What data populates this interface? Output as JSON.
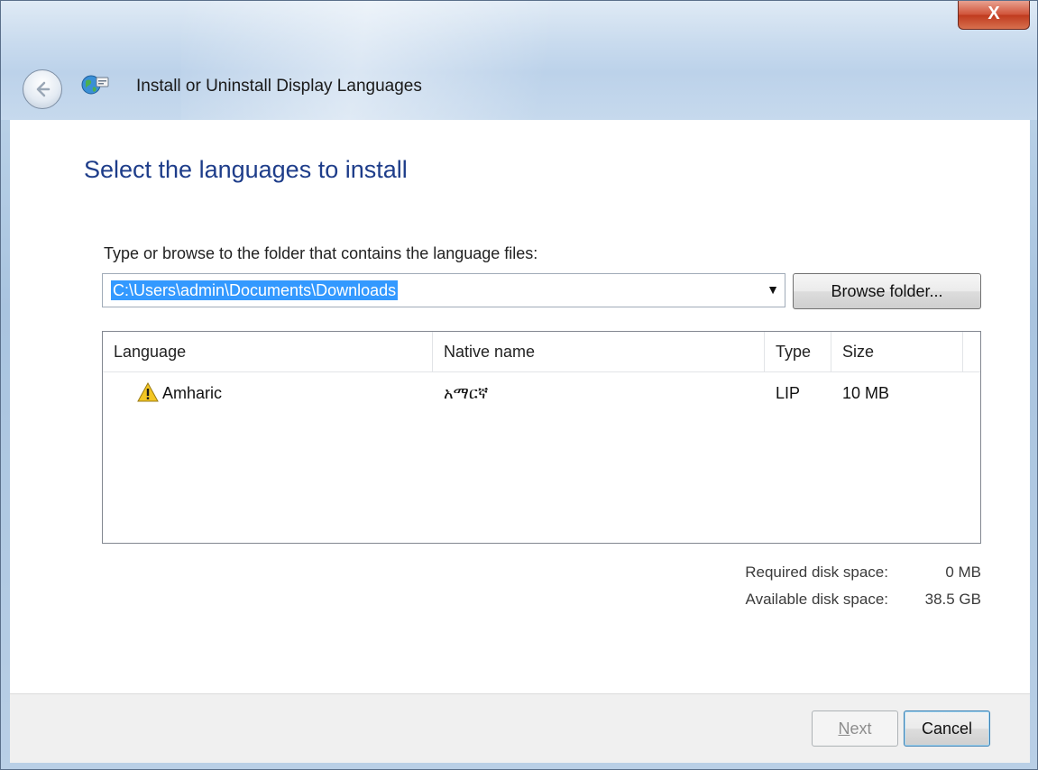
{
  "window": {
    "title": "Install or Uninstall Display Languages",
    "close_glyph": "X"
  },
  "header": {
    "heading": "Select the languages to install",
    "folder_label": "Type or browse to the folder that contains the language files:"
  },
  "folder": {
    "path": "C:\\Users\\admin\\Documents\\Downloads",
    "browse_label": "Browse folder..."
  },
  "list": {
    "columns": [
      "Language",
      "Native name",
      "Type",
      "Size"
    ],
    "rows": [
      {
        "language": "Amharic",
        "native": "አማርኛ",
        "type": "LIP",
        "size": "10 MB",
        "icon": "warning-icon"
      }
    ]
  },
  "disk": {
    "required_label": "Required disk space:",
    "required_value": "0 MB",
    "available_label": "Available disk space:",
    "available_value": "38.5 GB"
  },
  "footer": {
    "next_label": "Next",
    "cancel_label": "Cancel"
  },
  "icons": {
    "back": "back-arrow-icon",
    "app": "globe-language-icon",
    "dropdown": "chevron-down-icon"
  },
  "colors": {
    "heading": "#1e3d8a",
    "selection": "#3399ff",
    "close": "#c03b1f"
  }
}
